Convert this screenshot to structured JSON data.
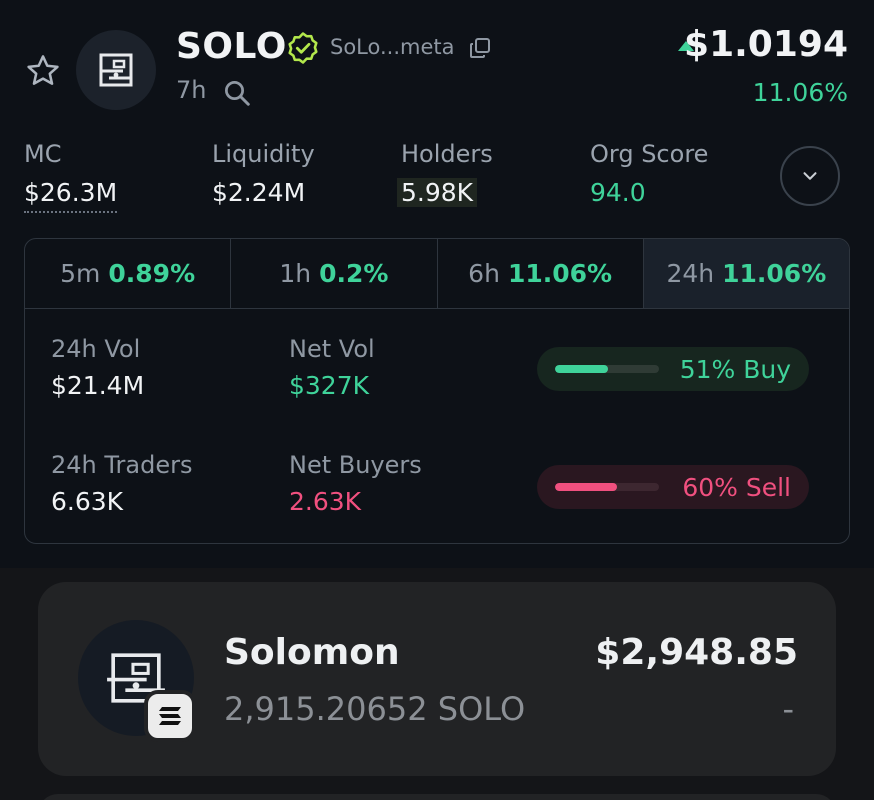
{
  "header": {
    "title": "SOLO",
    "meta_link": "SoLo...meta",
    "age": "7h",
    "price": "$1.0194",
    "price_change": "11.06%"
  },
  "stats": [
    {
      "label": "MC",
      "value": "$26.3M"
    },
    {
      "label": "Liquidity",
      "value": "$2.24M"
    },
    {
      "label": "Holders",
      "value": "5.98K"
    },
    {
      "label": "Org Score",
      "value": "94.0"
    }
  ],
  "tabs": [
    {
      "label": "5m",
      "value": "0.89%"
    },
    {
      "label": "1h",
      "value": "0.2%"
    },
    {
      "label": "6h",
      "value": "11.06%"
    },
    {
      "label": "24h",
      "value": "11.06%"
    }
  ],
  "activity": {
    "vol_label": "24h Vol",
    "vol_value": "$21.4M",
    "net_vol_label": "Net Vol",
    "net_vol_value": "$327K",
    "buy_label": "51% Buy",
    "buy_fraction": 0.51,
    "traders_label": "24h Traders",
    "traders_value": "6.63K",
    "net_buyers_label": "Net Buyers",
    "net_buyers_value": "2.63K",
    "sell_label": "60% Sell",
    "sell_fraction": 0.6
  },
  "holding": {
    "name": "Solomon",
    "amount": "2,915.20652 SOLO",
    "value": "$2,948.85",
    "change": "-"
  },
  "colors": {
    "green": "#3fd39a",
    "pink": "#f0507f",
    "background": "#0d1117"
  },
  "icons": [
    "star-icon",
    "token-logo",
    "verified-icon",
    "copy-icon",
    "search-icon",
    "price-up-icon",
    "chevron-down-icon",
    "solana-badge-icon"
  ]
}
